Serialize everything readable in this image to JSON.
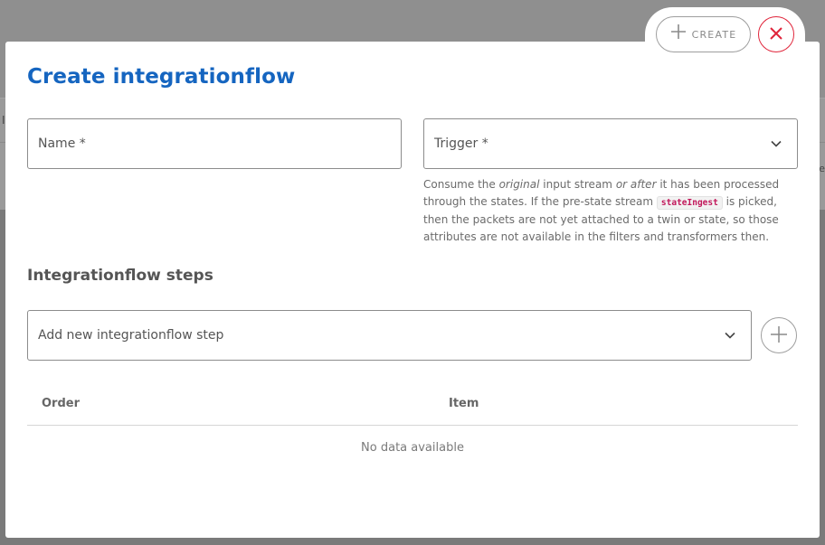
{
  "background": {
    "left_text": "I",
    "right_text": "pe"
  },
  "dialog": {
    "title": "Create integrationflow",
    "actions": {
      "create_label": "CREATE",
      "create_icon": "plus-icon",
      "close_icon": "close-icon"
    },
    "fields": {
      "name": {
        "label": "Name *",
        "value": ""
      },
      "trigger": {
        "label": "Trigger *",
        "value": "",
        "icon": "chevron-down-icon"
      }
    },
    "trigger_hint": {
      "part1": "Consume the ",
      "em1": "original",
      "part2": " input stream ",
      "em2": "or after",
      "part3": " it has been processed through the states. If the pre-state stream ",
      "code": "stateIngest",
      "part4": " is picked, then the packets are not yet attached to a twin or state, so those attributes are not available in the filters and transformers then."
    },
    "steps": {
      "heading": "Integrationflow steps",
      "select_label": "Add new integrationflow step",
      "add_icon": "plus-icon",
      "table": {
        "columns": [
          "Order",
          "Item"
        ],
        "empty_text": "No data available"
      }
    }
  },
  "colors": {
    "accent": "#1565c0",
    "danger": "#e0243a",
    "overlay": "#8f8f8f"
  }
}
